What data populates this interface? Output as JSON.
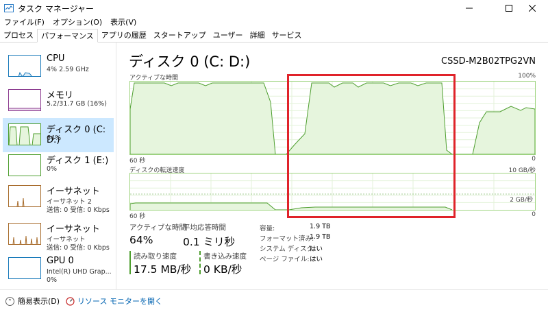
{
  "window": {
    "title": "タスク マネージャー"
  },
  "menu": [
    "ファイル(F)",
    "オプション(O)",
    "表示(V)"
  ],
  "tabs": [
    {
      "label": "プロセス",
      "active": false
    },
    {
      "label": "パフォーマンス",
      "active": true
    },
    {
      "label": "アプリの履歴",
      "active": false
    },
    {
      "label": "スタートアップ",
      "active": false
    },
    {
      "label": "ユーザー",
      "active": false
    },
    {
      "label": "詳細",
      "active": false
    },
    {
      "label": "サービス",
      "active": false
    }
  ],
  "sidebar": {
    "items": [
      {
        "title": "CPU",
        "sub": "4% 2.59 GHz",
        "sub2": "",
        "color": "#1779ba"
      },
      {
        "title": "メモリ",
        "sub": "5.2/31.7 GB (16%)",
        "sub2": "",
        "color": "#8b3a8f"
      },
      {
        "title": "ディスク 0 (C: D:)",
        "sub": "64%",
        "sub2": "",
        "color": "#4d9e2e"
      },
      {
        "title": "ディスク 1 (E:)",
        "sub": "0%",
        "sub2": "",
        "color": "#4d9e2e"
      },
      {
        "title": "イーサネット",
        "sub": "イーサネット 2",
        "sub2": "送信: 0 受信: 0 Kbps",
        "color": "#a76b2b"
      },
      {
        "title": "イーサネット",
        "sub": "イーサネット",
        "sub2": "送信: 0 受信: 0 Kbps",
        "color": "#a76b2b"
      },
      {
        "title": "GPU 0",
        "sub": "Intel(R) UHD Grap...",
        "sub2": "0%",
        "color": "#1779ba"
      }
    ]
  },
  "main": {
    "title": "ディスク 0 (C: D:)",
    "model": "CSSD-M2B02TPG2VN",
    "graph1": {
      "label": "アクティブな時間",
      "max": "100%",
      "time": "60 秒",
      "min": "0"
    },
    "graph2": {
      "label": "ディスクの転送速度",
      "max": "10 GB/秒",
      "mid": "2 GB/秒",
      "time": "60 秒",
      "min": "0"
    },
    "stats": {
      "active_label": "アクティブな時間",
      "active_value": "64%",
      "resp_label": "平均応答時間",
      "resp_value": "0.1 ミリ秒",
      "read_label": "読み取り速度",
      "read_value": "17.5 MB/秒",
      "write_label": "書き込み速度",
      "write_value": "0 KB/秒"
    },
    "props": [
      {
        "label": "容量:",
        "value": "1.9 TB"
      },
      {
        "label": "フォーマット済み:",
        "value": "1.9 TB"
      },
      {
        "label": "システム ディスク:",
        "value": "はい"
      },
      {
        "label": "ページ ファイル:",
        "value": "はい"
      }
    ]
  },
  "footer": {
    "summary": "簡易表示(D)",
    "monitor": "リソース モニターを開く"
  },
  "colors": {
    "disk_line": "#4d9e2e",
    "disk_fill": "#e6f5dd",
    "grid": "#e3f2d9",
    "highlight": "#e0232a"
  }
}
